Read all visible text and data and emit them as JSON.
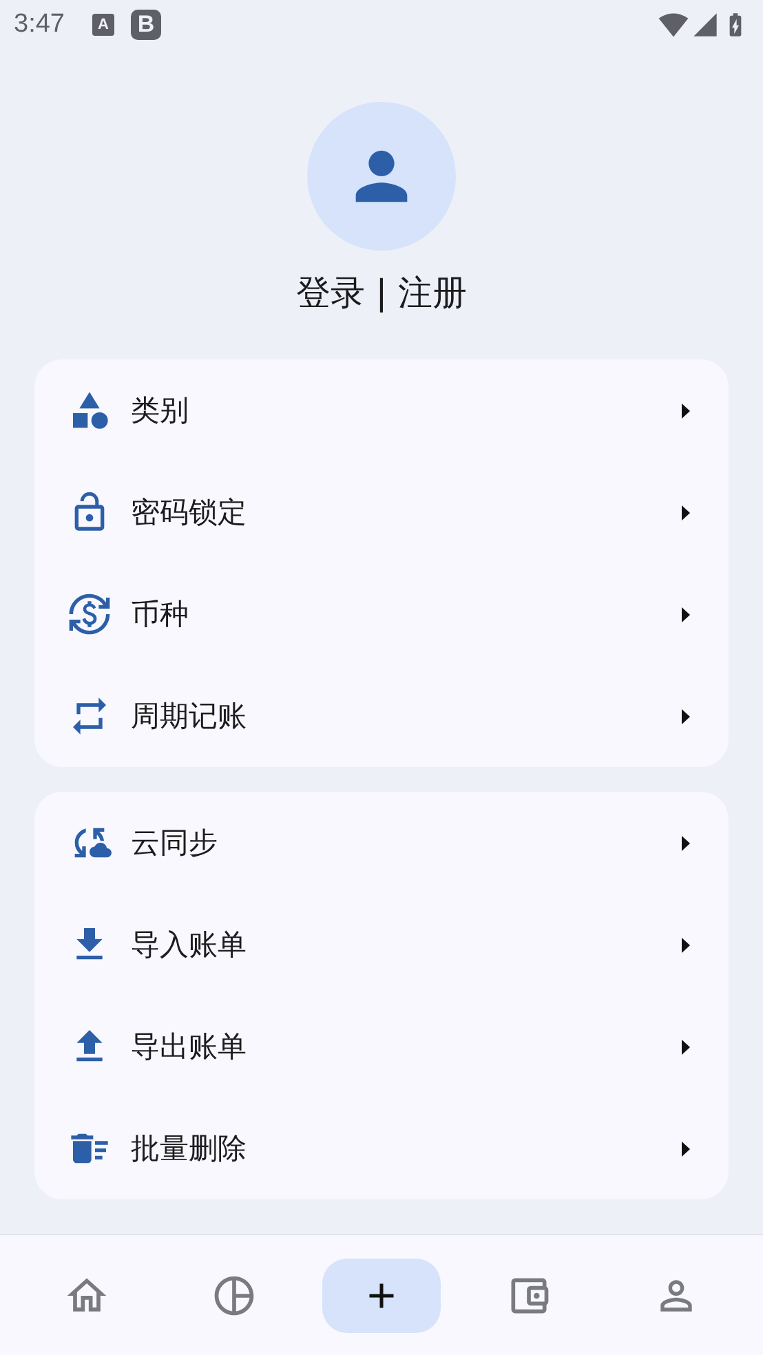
{
  "status_bar": {
    "time": "3:47",
    "notifications": [
      "A",
      "B"
    ]
  },
  "profile": {
    "login_link": "登录 | 注册"
  },
  "menu_groups": [
    {
      "items": [
        {
          "label": "类别"
        },
        {
          "label": "密码锁定"
        },
        {
          "label": "币种"
        },
        {
          "label": "周期记账"
        }
      ]
    },
    {
      "items": [
        {
          "label": "云同步"
        },
        {
          "label": "导入账单"
        },
        {
          "label": "导出账单"
        },
        {
          "label": "批量删除"
        }
      ]
    }
  ],
  "bottom_nav": [
    {
      "selected": false
    },
    {
      "selected": false
    },
    {
      "selected": true
    },
    {
      "selected": false
    },
    {
      "selected": false
    }
  ]
}
